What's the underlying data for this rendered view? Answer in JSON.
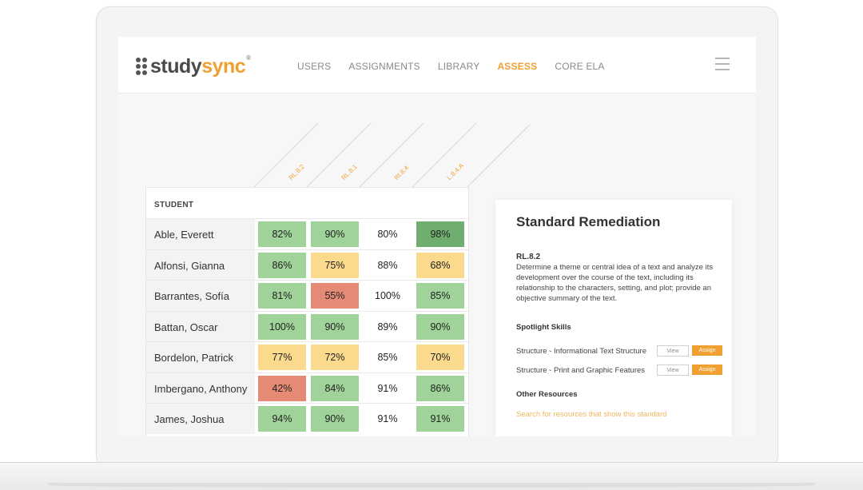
{
  "brand": {
    "study": "study",
    "sync": "sync",
    "tm": "®"
  },
  "nav": [
    {
      "label": "USERS",
      "active": false
    },
    {
      "label": "ASSIGNMENTS",
      "active": false
    },
    {
      "label": "LIBRARY",
      "active": false
    },
    {
      "label": "ASSESS",
      "active": true
    },
    {
      "label": "CORE ELA",
      "active": false
    }
  ],
  "icons": {
    "menu": "hamburger-menu-icon",
    "logo": "studysync-dots-icon"
  },
  "colors": {
    "accent": "#f0a030",
    "green": "#9fd39a",
    "dark_green": "#6fae6e",
    "yellow": "#fbd98d",
    "red": "#e58b75"
  },
  "table": {
    "student_header": "STUDENT",
    "standards": [
      "RL.8.2",
      "RL.8.1",
      "RI.8.4",
      "L.8.4.A"
    ],
    "rows": [
      {
        "student": "Able, Everett",
        "scores": [
          {
            "value": "82%",
            "level": "green"
          },
          {
            "value": "90%",
            "level": "green"
          },
          {
            "value": "80%",
            "level": "plain"
          },
          {
            "value": "98%",
            "level": "dark_green"
          }
        ]
      },
      {
        "student": "Alfonsi, Gianna",
        "scores": [
          {
            "value": "86%",
            "level": "green"
          },
          {
            "value": "75%",
            "level": "yellow"
          },
          {
            "value": "88%",
            "level": "plain"
          },
          {
            "value": "68%",
            "level": "yellow"
          }
        ]
      },
      {
        "student": "Barrantes, Sofía",
        "scores": [
          {
            "value": "81%",
            "level": "green"
          },
          {
            "value": "55%",
            "level": "red"
          },
          {
            "value": "100%",
            "level": "plain"
          },
          {
            "value": "85%",
            "level": "green"
          }
        ]
      },
      {
        "student": "Battan, Oscar",
        "scores": [
          {
            "value": "100%",
            "level": "green"
          },
          {
            "value": "90%",
            "level": "green"
          },
          {
            "value": "89%",
            "level": "plain"
          },
          {
            "value": "90%",
            "level": "green"
          }
        ]
      },
      {
        "student": "Bordelon, Patrick",
        "scores": [
          {
            "value": "77%",
            "level": "yellow"
          },
          {
            "value": "72%",
            "level": "yellow"
          },
          {
            "value": "85%",
            "level": "plain"
          },
          {
            "value": "70%",
            "level": "yellow"
          }
        ]
      },
      {
        "student": "Imbergano, Anthony",
        "scores": [
          {
            "value": "42%",
            "level": "red"
          },
          {
            "value": "84%",
            "level": "green"
          },
          {
            "value": "91%",
            "level": "plain"
          },
          {
            "value": "86%",
            "level": "green"
          }
        ]
      },
      {
        "student": "James, Joshua",
        "scores": [
          {
            "value": "94%",
            "level": "green"
          },
          {
            "value": "90%",
            "level": "green"
          },
          {
            "value": "91%",
            "level": "plain"
          },
          {
            "value": "91%",
            "level": "green"
          }
        ]
      }
    ]
  },
  "panel": {
    "title": "Standard Remediation",
    "standard_code": "RL.8.2",
    "standard_description": "Determine a theme or central idea of a text and analyze its development over the course of the text, including its relationship to the characters, setting, and plot; provide an objective summary of the text.",
    "spotlight_title": "Spotlight Skills",
    "skills": [
      {
        "name": "Structure - Informational Text Structure",
        "view": "View",
        "assign": "Assign"
      },
      {
        "name": "Structure - Print and Graphic Features",
        "view": "View",
        "assign": "Assign"
      }
    ],
    "other_title": "Other Resources",
    "search_link": "Search for resources that show this standard"
  }
}
